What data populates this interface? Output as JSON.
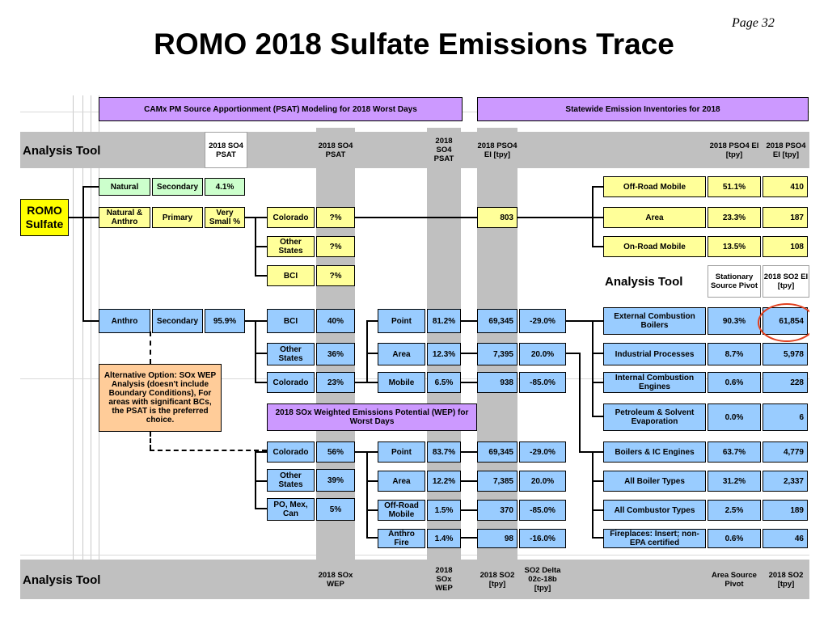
{
  "page_number": "Page 32",
  "title": "ROMO 2018 Sulfate Emissions Trace",
  "headers": {
    "psat_banner": "CAMx PM Source Apportionment (PSAT) Modeling for 2018 Worst Days",
    "inventory_banner": "Statewide Emission Inventories for 2018",
    "wep_banner": "2018 SOx Weighted Emissions Potential (WEP) for Worst Days"
  },
  "analysis_tool": {
    "top": "Analysis Tool",
    "middle": "Analysis Tool",
    "bottom": "Analysis Tool"
  },
  "column_headers": {
    "psat_1": "2018 SO4 PSAT",
    "psat_2": "2018 SO4 PSAT",
    "psat_3": "2018 SO4 PSAT",
    "pso4_ei": "2018 PSO4 EI [tpy]",
    "pso4_pct": "2018 PSO4 EI [tpy]",
    "pso4_tpy": "2018 PSO4 EI [tpy]",
    "stationary": "Stationary Source Pivot",
    "so2_ei": "2018 SO2 EI [tpy]",
    "wep_1": "2018 SOx WEP",
    "wep_2": "2018 SOx WEP",
    "so2_tpy": "2018 SO2 [tpy]",
    "so2_delta": "SO2 Delta 02c-18b [tpy]",
    "area_pivot": "Area Source Pivot",
    "so2_tpy_2": "2018 SO2 [tpy]"
  },
  "root": "ROMO Sulfate",
  "origin_rows": [
    {
      "source": "Natural",
      "type": "Secondary",
      "share": "4.1%"
    },
    {
      "source": "Natural & Anthro",
      "type": "Primary",
      "share": "Very Small %"
    },
    {
      "source": "Anthro",
      "type": "Secondary",
      "share": "95.9%"
    }
  ],
  "primary_regions": [
    {
      "name": "Colorado",
      "share": "?%"
    },
    {
      "name": "Other States",
      "share": "?%"
    },
    {
      "name": "BCI",
      "share": "?%"
    }
  ],
  "primary_ei": "803",
  "pso4_sources": [
    {
      "name": "Off-Road Mobile",
      "pct": "51.1%",
      "tpy": "410"
    },
    {
      "name": "Area",
      "pct": "23.3%",
      "tpy": "187"
    },
    {
      "name": "On-Road Mobile",
      "pct": "13.5%",
      "tpy": "108"
    }
  ],
  "psat_regions": [
    {
      "name": "BCI",
      "share": "40%"
    },
    {
      "name": "Other States",
      "share": "36%"
    },
    {
      "name": "Colorado",
      "share": "23%"
    }
  ],
  "psat_sectors": [
    {
      "name": "Point",
      "share": "81.2%",
      "so2": "69,345",
      "delta": "-29.0%"
    },
    {
      "name": "Area",
      "share": "12.3%",
      "so2": "7,395",
      "delta": "20.0%"
    },
    {
      "name": "Mobile",
      "share": "6.5%",
      "so2": "938",
      "delta": "-85.0%"
    }
  ],
  "wep_regions": [
    {
      "name": "Colorado",
      "share": "56%"
    },
    {
      "name": "Other States",
      "share": "39%"
    },
    {
      "name": "PO, Mex, Can",
      "share": "5%"
    }
  ],
  "wep_sectors": [
    {
      "name": "Point",
      "share": "83.7%",
      "so2": "69,345",
      "delta": "-29.0%"
    },
    {
      "name": "Area",
      "share": "12.2%",
      "so2": "7,385",
      "delta": "20.0%"
    },
    {
      "name": "Off-Road Mobile",
      "share": "1.5%",
      "so2": "370",
      "delta": "-85.0%"
    },
    {
      "name": "Anthro Fire",
      "share": "1.4%",
      "so2": "98",
      "delta": "-16.0%"
    }
  ],
  "stationary_sources": [
    {
      "name": "External Combustion Boilers",
      "pct": "90.3%",
      "tpy": "61,854"
    },
    {
      "name": "Industrial Processes",
      "pct": "8.7%",
      "tpy": "5,978"
    },
    {
      "name": "Internal Combustion Engines",
      "pct": "0.6%",
      "tpy": "228"
    },
    {
      "name": "Petroleum & Solvent Evaporation",
      "pct": "0.0%",
      "tpy": "6"
    }
  ],
  "area_sources": [
    {
      "name": "Boilers & IC Engines",
      "pct": "63.7%",
      "tpy": "4,779"
    },
    {
      "name": "All Boiler Types",
      "pct": "31.2%",
      "tpy": "2,337"
    },
    {
      "name": "All Combustor Types",
      "pct": "2.5%",
      "tpy": "189"
    },
    {
      "name": "Fireplaces: Insert; non-EPA certified",
      "pct": "0.6%",
      "tpy": "46"
    }
  ],
  "alternative_note": "Alternative Option: SOx WEP Analysis (doesn't include Boundary Conditions), For areas with significant BCs, the PSAT is the preferred choice.",
  "colors": {
    "green": "#ccffcc",
    "yellow": "#ffff99",
    "blue": "#99ccff",
    "purple": "#cc99ff",
    "orange": "#ffcc99",
    "root_yellow": "#ffff00",
    "highlight_circle": "#e0401f",
    "band_gray": "#c0c0c0"
  }
}
